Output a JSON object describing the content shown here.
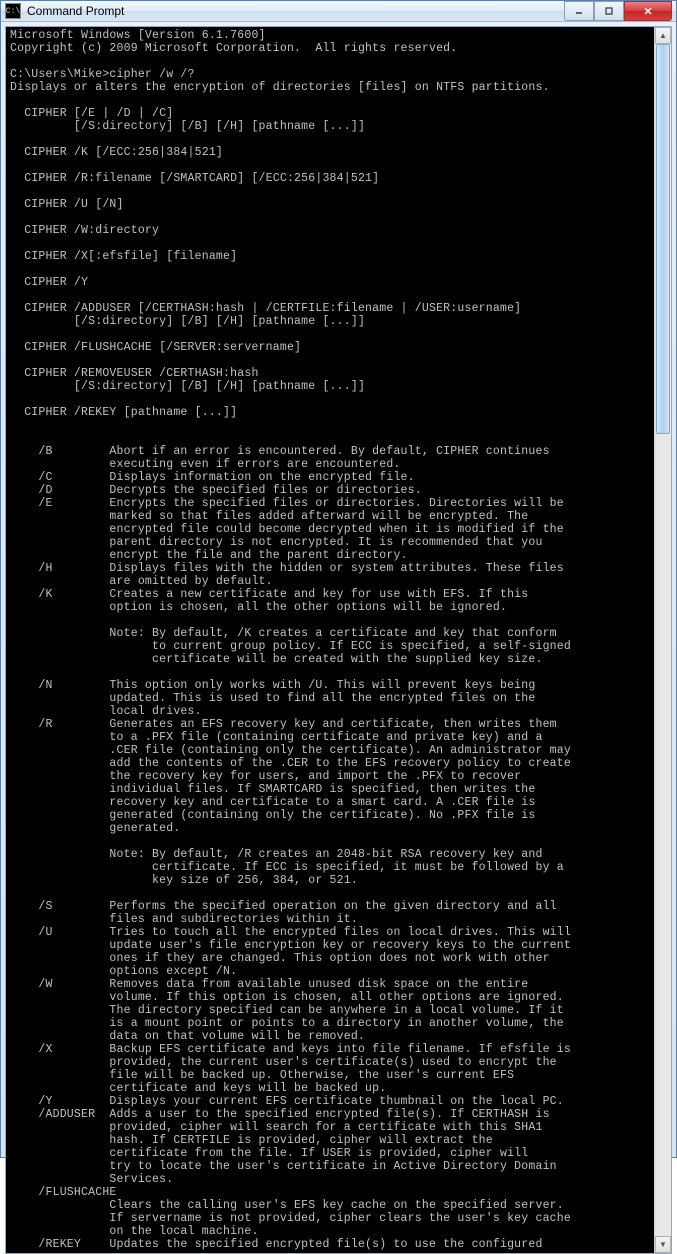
{
  "window": {
    "title": "Command Prompt",
    "icon_glyph": "C:\\"
  },
  "terminal": {
    "lines": [
      "Microsoft Windows [Version 6.1.7600]",
      "Copyright (c) 2009 Microsoft Corporation.  All rights reserved.",
      "",
      "C:\\Users\\Mike>cipher /w /?",
      "Displays or alters the encryption of directories [files] on NTFS partitions.",
      "",
      "  CIPHER [/E | /D | /C]",
      "         [/S:directory] [/B] [/H] [pathname [...]]",
      "",
      "  CIPHER /K [/ECC:256|384|521]",
      "",
      "  CIPHER /R:filename [/SMARTCARD] [/ECC:256|384|521]",
      "",
      "  CIPHER /U [/N]",
      "",
      "  CIPHER /W:directory",
      "",
      "  CIPHER /X[:efsfile] [filename]",
      "",
      "  CIPHER /Y",
      "",
      "  CIPHER /ADDUSER [/CERTHASH:hash | /CERTFILE:filename | /USER:username]",
      "         [/S:directory] [/B] [/H] [pathname [...]]",
      "",
      "  CIPHER /FLUSHCACHE [/SERVER:servername]",
      "",
      "  CIPHER /REMOVEUSER /CERTHASH:hash",
      "         [/S:directory] [/B] [/H] [pathname [...]]",
      "",
      "  CIPHER /REKEY [pathname [...]]",
      "",
      "",
      "    /B        Abort if an error is encountered. By default, CIPHER continues",
      "              executing even if errors are encountered.",
      "    /C        Displays information on the encrypted file.",
      "    /D        Decrypts the specified files or directories.",
      "    /E        Encrypts the specified files or directories. Directories will be",
      "              marked so that files added afterward will be encrypted. The",
      "              encrypted file could become decrypted when it is modified if the",
      "              parent directory is not encrypted. It is recommended that you",
      "              encrypt the file and the parent directory.",
      "    /H        Displays files with the hidden or system attributes. These files",
      "              are omitted by default.",
      "    /K        Creates a new certificate and key for use with EFS. If this",
      "              option is chosen, all the other options will be ignored.",
      "",
      "              Note: By default, /K creates a certificate and key that conform",
      "                    to current group policy. If ECC is specified, a self-signed",
      "                    certificate will be created with the supplied key size.",
      "",
      "    /N        This option only works with /U. This will prevent keys being",
      "              updated. This is used to find all the encrypted files on the",
      "              local drives.",
      "    /R        Generates an EFS recovery key and certificate, then writes them",
      "              to a .PFX file (containing certificate and private key) and a",
      "              .CER file (containing only the certificate). An administrator may",
      "              add the contents of the .CER to the EFS recovery policy to create",
      "              the recovery key for users, and import the .PFX to recover",
      "              individual files. If SMARTCARD is specified, then writes the",
      "              recovery key and certificate to a smart card. A .CER file is",
      "              generated (containing only the certificate). No .PFX file is",
      "              generated.",
      "",
      "              Note: By default, /R creates an 2048-bit RSA recovery key and",
      "                    certificate. If ECC is specified, it must be followed by a",
      "                    key size of 256, 384, or 521.",
      "",
      "    /S        Performs the specified operation on the given directory and all",
      "              files and subdirectories within it.",
      "    /U        Tries to touch all the encrypted files on local drives. This will",
      "              update user's file encryption key or recovery keys to the current",
      "              ones if they are changed. This option does not work with other",
      "              options except /N.",
      "    /W        Removes data from available unused disk space on the entire",
      "              volume. If this option is chosen, all other options are ignored.",
      "              The directory specified can be anywhere in a local volume. If it",
      "              is a mount point or points to a directory in another volume, the",
      "              data on that volume will be removed.",
      "    /X        Backup EFS certificate and keys into file filename. If efsfile is",
      "              provided, the current user's certificate(s) used to encrypt the",
      "              file will be backed up. Otherwise, the user's current EFS",
      "              certificate and keys will be backed up.",
      "    /Y        Displays your current EFS certificate thumbnail on the local PC.",
      "    /ADDUSER  Adds a user to the specified encrypted file(s). If CERTHASH is",
      "              provided, cipher will search for a certificate with this SHA1",
      "              hash. If CERTFILE is provided, cipher will extract the",
      "              certificate from the file. If USER is provided, cipher will",
      "              try to locate the user's certificate in Active Directory Domain",
      "              Services.",
      "    /FLUSHCACHE",
      "              Clears the calling user's EFS key cache on the specified server.",
      "              If servername is not provided, cipher clears the user's key cache",
      "              on the local machine.",
      "    /REKEY    Updates the specified encrypted file(s) to use the configured"
    ]
  }
}
